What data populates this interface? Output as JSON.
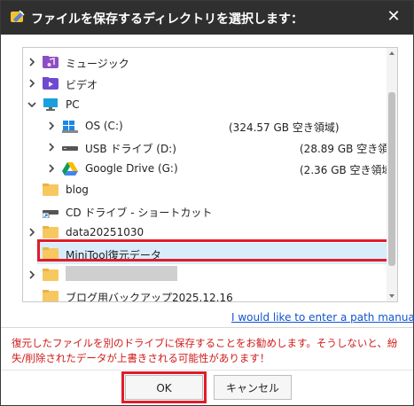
{
  "dialog": {
    "title": "ファイルを保存するディレクトリを選択します：",
    "close_glyph": "✕"
  },
  "tree": {
    "items": [
      {
        "label": "ミュージック",
        "icon": "music-folder-icon",
        "expand": "collapsed",
        "level": 0
      },
      {
        "label": "ビデオ",
        "icon": "video-folder-icon",
        "expand": "collapsed",
        "level": 0
      },
      {
        "label": "PC",
        "icon": "pc-monitor-icon",
        "expand": "expanded",
        "level": 0
      },
      {
        "label": "OS (C:)",
        "extra": "(324.57 GB 空き領域)",
        "icon": "windows-drive-icon",
        "expand": "collapsed",
        "level": 1
      },
      {
        "label": "USB ドライブ (D:)",
        "extra": "(28.89 GB 空き領域",
        "icon": "usb-drive-icon",
        "expand": "collapsed",
        "level": 1
      },
      {
        "label": "Google Drive (G:)",
        "extra": "(2.36 GB 空き領域",
        "icon": "google-drive-icon",
        "expand": "collapsed",
        "level": 1
      },
      {
        "label": "blog",
        "icon": "folder-icon",
        "expand": "none",
        "level": 0
      },
      {
        "label": "CD ドライブ - ショートカット",
        "icon": "shortcut-drive-icon",
        "expand": "none",
        "level": 0
      },
      {
        "label": "data20251030",
        "icon": "folder-icon",
        "expand": "collapsed",
        "level": 0
      },
      {
        "label": "MiniTool復元データ",
        "icon": "folder-icon",
        "expand": "none",
        "level": 0,
        "selected": true
      },
      {
        "label": "",
        "icon": "folder-icon",
        "expand": "collapsed",
        "level": 0,
        "redacted": true
      },
      {
        "label": "ブログ用バックアップ2025.12.16",
        "icon": "folder-icon",
        "expand": "none",
        "level": 0
      }
    ]
  },
  "manual_link": "I would like to enter a path manually.",
  "warning": "復元したファイルを別のドライブに保存することをお勧めします。そうしないと、紛失/削除されたデータが上書きされる可能性があります！",
  "buttons": {
    "ok": "OK",
    "cancel": "キャンセル"
  },
  "colors": {
    "titlebar": "#2f2f2f",
    "highlight_red": "#e01c2a",
    "link_blue": "#1155cc",
    "warning_red": "#d01a1a",
    "selected_bg": "#d9ecfb"
  }
}
